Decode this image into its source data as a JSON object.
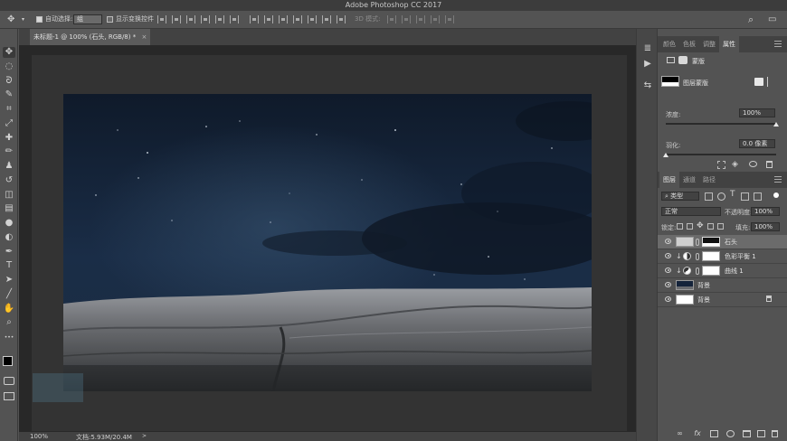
{
  "app": {
    "title": "Adobe Photoshop CC 2017"
  },
  "options_bar": {
    "auto_select_label": "自动选择:",
    "auto_select_value": "组",
    "show_transform_label": "显示变换控件",
    "mode_3d_label": "3D 模式:"
  },
  "document": {
    "tab_label": "未标题-1 @ 100% (石头, RGB/8) *",
    "close_glyph": "×"
  },
  "status_bar": {
    "zoom": "100%",
    "doc_size": "文档:5.93M/20.4M"
  },
  "properties_panel": {
    "tabs": [
      "颜色",
      "色板",
      "调整",
      "属性"
    ],
    "active_tab": 3,
    "mask_header": "蒙版",
    "layer_mask_label": "图层蒙版",
    "density_label": "浓度:",
    "density_value": "100%",
    "density_level": 1.0,
    "feather_label": "羽化:",
    "feather_value": "0.0 像素",
    "feather_level": 0.0
  },
  "layers_panel": {
    "tabs": [
      "图层",
      "通道",
      "路径"
    ],
    "active_tab": 0,
    "filter_kind": "类型",
    "blend_mode": "正常",
    "opacity_label": "不透明度:",
    "opacity_value": "100%",
    "lock_label": "锁定:",
    "fill_label": "填充:",
    "fill_value": "100%",
    "layers": [
      {
        "name": "石头",
        "kind": "image-mask",
        "selected": true
      },
      {
        "name": "色彩平衡 1",
        "kind": "adjustment-balance",
        "clipped": true
      },
      {
        "name": "曲线 1",
        "kind": "adjustment-curves",
        "clipped": true
      },
      {
        "name": "背景",
        "kind": "image-sky"
      },
      {
        "name": "背景",
        "kind": "white-locked"
      }
    ]
  },
  "icons": {
    "move": "✥",
    "marquee": "◌",
    "lasso": "ᘐ",
    "quick_select": "✎",
    "crop": "⌗",
    "eyedropper": "⤢",
    "heal": "✚",
    "brush": "✏",
    "stamp": "♟",
    "history": "↺",
    "eraser": "◫",
    "gradient": "▤",
    "blur": "●",
    "dodge": "◐",
    "pen": "✒",
    "type": "T",
    "path_select": "➤",
    "line": "╱",
    "hand": "✋",
    "zoom": "⌕",
    "more": "•••",
    "search": "⌕",
    "workspace": "▭",
    "play": "▶",
    "history_panel": "⇆",
    "fx": "fx",
    "lock": "🔒"
  },
  "colors": {
    "sky_top": "#0f1a2a",
    "sky_mid": "#1a2d47",
    "rock": "#7a7c80"
  }
}
